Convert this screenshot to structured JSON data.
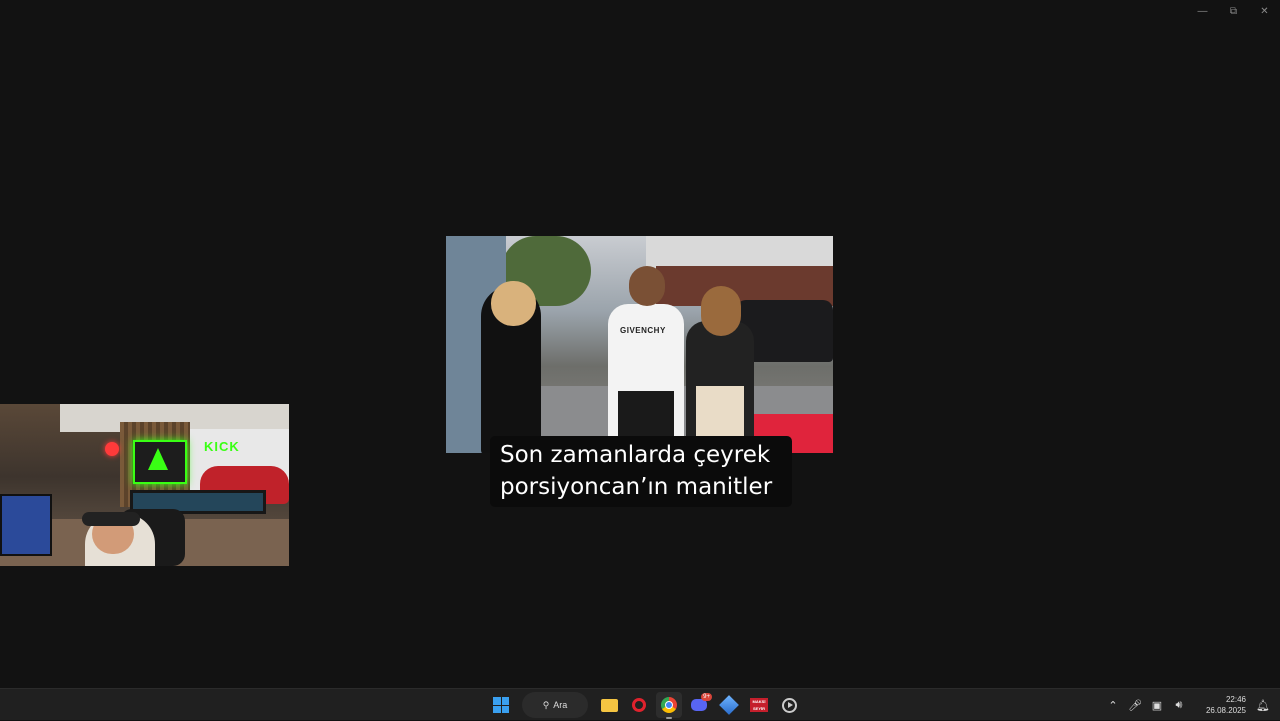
{
  "window": {
    "controls": [
      "minimize",
      "maximize",
      "close"
    ]
  },
  "video": {
    "scene": "street-video-frame",
    "shirt_text": "GIVENCHY",
    "subtitle_line1": "Son zamanlarda çeyrek",
    "subtitle_line2": "porsiyoncan’ın manitler"
  },
  "webcam": {
    "sign_text": "KICK"
  },
  "taskbar": {
    "search_label": "Ara",
    "apps": [
      "start-icon",
      "search",
      "file-explorer-icon",
      "opera-icon",
      "chrome-icon",
      "discord-icon",
      "kagi-icon",
      "red-app-icon",
      "media-player-icon"
    ],
    "discord_badge": "9+",
    "red_app_text": "MAKSİ SEYİR",
    "time": "22:46",
    "date": "26.08.2025",
    "tray_icons": [
      "chevron-up-icon",
      "microphone-icon",
      "network-icon",
      "volume-icon",
      "notification-icon"
    ]
  }
}
